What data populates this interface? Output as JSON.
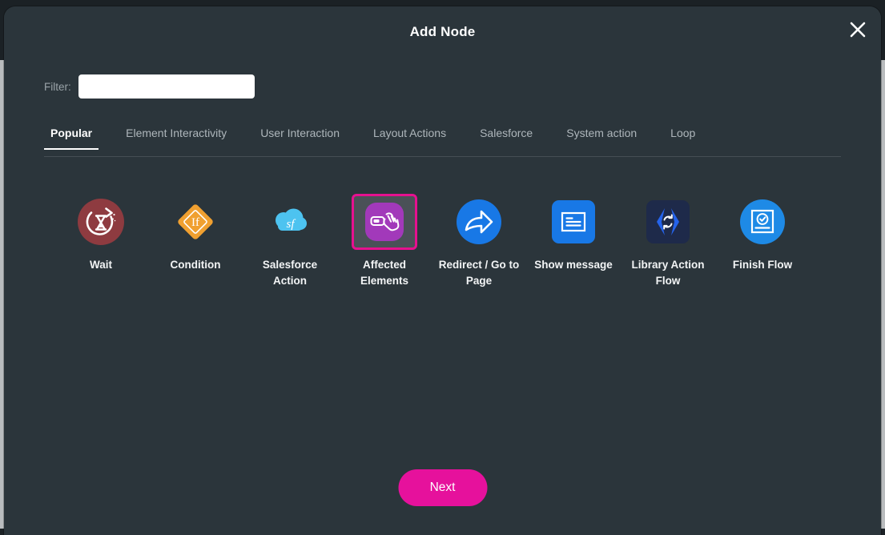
{
  "window": {
    "background_color": "#1b2125",
    "gutter_color": "#b9bcbe"
  },
  "modal": {
    "title": "Add Node",
    "background_color": "#2b353b",
    "close_icon": "close-icon"
  },
  "filter": {
    "label": "Filter:",
    "value": "",
    "placeholder": ""
  },
  "tabs": {
    "active_index": 0,
    "items": [
      {
        "label": "Popular"
      },
      {
        "label": "Element Interactivity"
      },
      {
        "label": "User Interaction"
      },
      {
        "label": "Layout Actions"
      },
      {
        "label": "Salesforce"
      },
      {
        "label": "System action"
      },
      {
        "label": "Loop"
      }
    ]
  },
  "nodes": {
    "selected_index": 3,
    "selection_color": "#e6118f",
    "items": [
      {
        "label": "Wait",
        "icon": "wait-hourglass-icon",
        "color": "#8e3b40"
      },
      {
        "label": "Condition",
        "icon": "condition-diamond-if-icon",
        "color": "#f0a030",
        "glyph": "If"
      },
      {
        "label": "Salesforce Action",
        "icon": "salesforce-cloud-icon",
        "color": "#4dc3f0",
        "glyph": "sf"
      },
      {
        "label": "Affected Elements",
        "icon": "affected-elements-hand-icon",
        "color": "#a239ba"
      },
      {
        "label": "Redirect / Go to Page",
        "icon": "redirect-arrow-icon",
        "color": "#1878e6"
      },
      {
        "label": "Show message",
        "icon": "show-message-icon",
        "color": "#1878e6"
      },
      {
        "label": "Library Action Flow",
        "icon": "library-action-flow-icon",
        "color": "#1e2a4a"
      },
      {
        "label": "Finish Flow",
        "icon": "finish-flow-check-icon",
        "color": "#1e8ae6"
      }
    ]
  },
  "footer": {
    "next_label": "Next",
    "next_color": "#e6119c"
  }
}
